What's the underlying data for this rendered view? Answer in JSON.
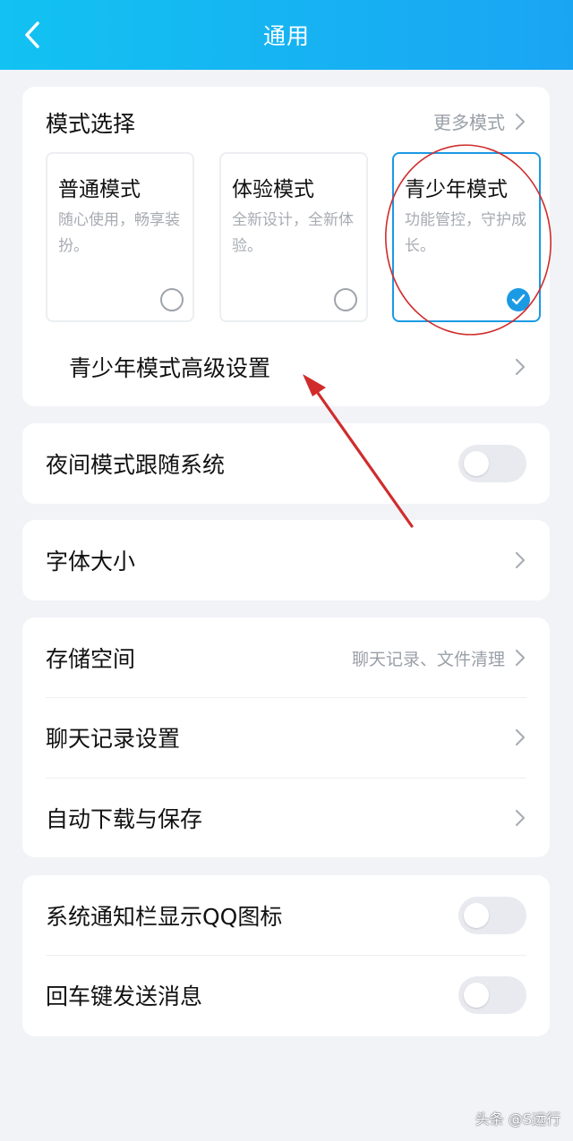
{
  "header": {
    "title": "通用",
    "back_icon": "chevron-left-icon"
  },
  "mode_section": {
    "title": "模式选择",
    "more_label": "更多模式",
    "modes": [
      {
        "name": "普通模式",
        "desc": "随心使用，畅享装扮。",
        "selected": false
      },
      {
        "name": "体验模式",
        "desc": "全新设计，全新体验。",
        "selected": false
      },
      {
        "name": "青少年模式",
        "desc": "功能管控，守护成长。",
        "selected": true
      }
    ],
    "advanced_label": "青少年模式高级设置"
  },
  "night_mode": {
    "label": "夜间模式跟随系统",
    "enabled": false
  },
  "font_size": {
    "label": "字体大小"
  },
  "storage_group": {
    "storage": {
      "label": "存储空间",
      "hint": "聊天记录、文件清理"
    },
    "chat_settings": {
      "label": "聊天记录设置"
    },
    "auto_download": {
      "label": "自动下载与保存"
    }
  },
  "notify_group": {
    "tray_icon": {
      "label": "系统通知栏显示QQ图标",
      "enabled": false
    },
    "enter_send": {
      "label": "回车键发送消息",
      "enabled": false
    }
  },
  "watermark": "头条 @S远行",
  "colors": {
    "header_start": "#12c2f2",
    "header_end": "#1aa5f3",
    "accent": "#1b9ae4",
    "annotation": "#d02c2c"
  }
}
